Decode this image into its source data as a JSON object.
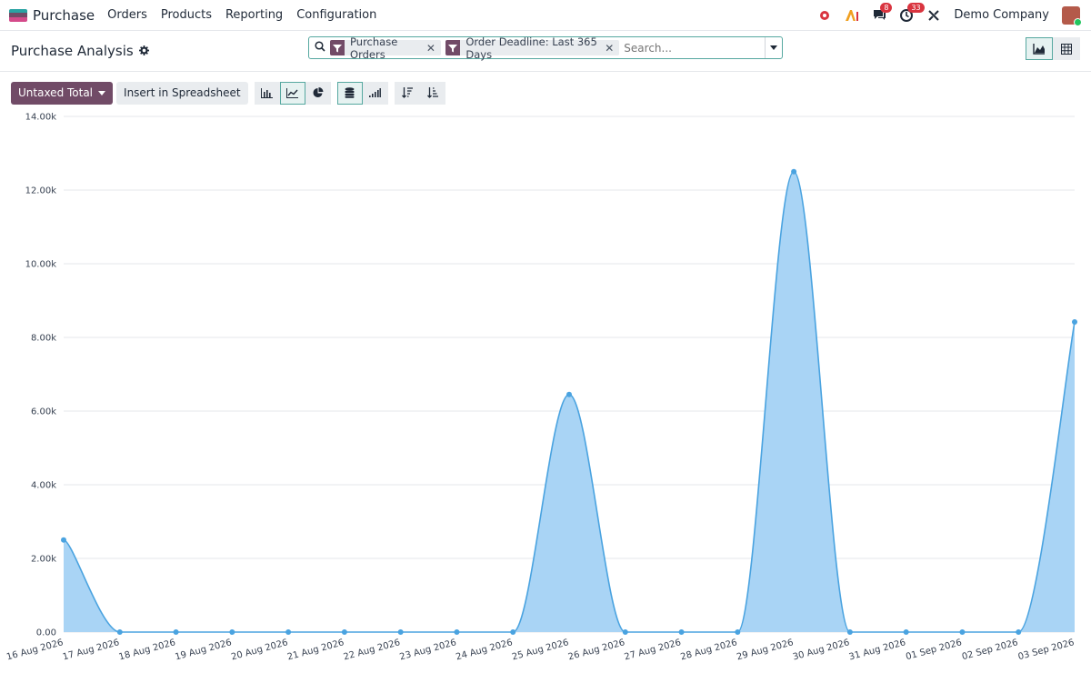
{
  "navbar": {
    "app_name": "Purchase",
    "menu": [
      "Orders",
      "Products",
      "Reporting",
      "Configuration"
    ],
    "chat_count": "8",
    "activity_count": "33",
    "company": "Demo Company",
    "brand_colors": [
      "#2aa3a3",
      "#714b67",
      "#d44a8a"
    ]
  },
  "control": {
    "title": "Purchase Analysis",
    "facets": [
      {
        "label": "Purchase Orders"
      },
      {
        "label": "Order Deadline: Last 365 Days"
      }
    ],
    "search_placeholder": "Search..."
  },
  "toolbar": {
    "measure_label": "Untaxed Total",
    "spreadsheet_label": "Insert in Spreadsheet"
  },
  "colors": {
    "accent": "#714b67",
    "teal": "#56a8a0",
    "area_fill": "#a9d4f5",
    "line": "#4aa3e0"
  },
  "chart_data": {
    "type": "area",
    "categories": [
      "16 Aug 2026",
      "17 Aug 2026",
      "18 Aug 2026",
      "19 Aug 2026",
      "20 Aug 2026",
      "21 Aug 2026",
      "22 Aug 2026",
      "23 Aug 2026",
      "24 Aug 2026",
      "25 Aug 2026",
      "26 Aug 2026",
      "27 Aug 2026",
      "28 Aug 2026",
      "29 Aug 2026",
      "30 Aug 2026",
      "31 Aug 2026",
      "01 Sep 2026",
      "02 Sep 2026",
      "03 Sep 2026"
    ],
    "series": [
      {
        "values": [
          2500,
          0,
          0,
          0,
          0,
          0,
          0,
          0,
          0,
          6450,
          0,
          0,
          0,
          12500,
          0,
          0,
          0,
          0,
          8420
        ]
      }
    ],
    "yticks": [
      "0.00",
      "2.00k",
      "4.00k",
      "6.00k",
      "8.00k",
      "10.00k",
      "12.00k",
      "14.00k"
    ],
    "ylim": [
      0,
      14000
    ],
    "grid": true
  }
}
